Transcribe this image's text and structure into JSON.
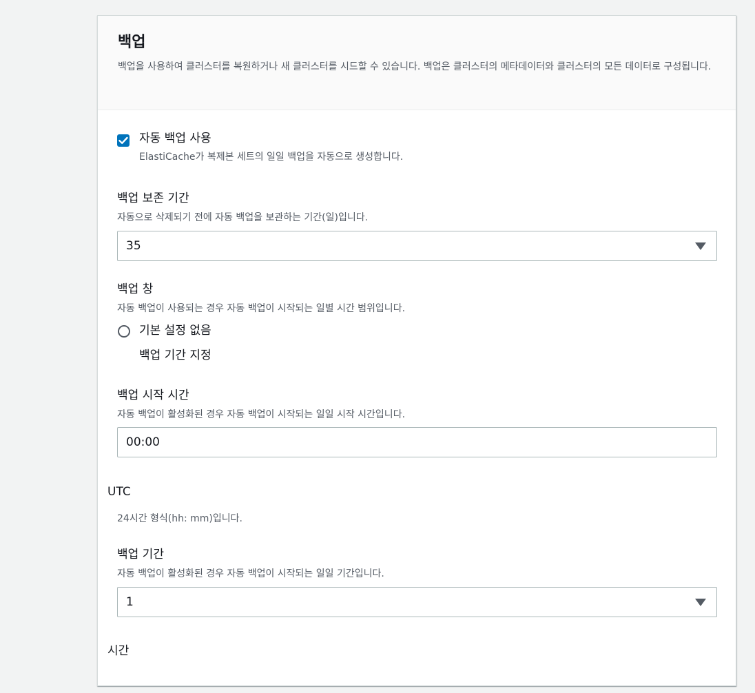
{
  "panel": {
    "title": "백업",
    "description": "백업을 사용하여 클러스터를 복원하거나 새 클러스터를 시드할 수 있습니다. 백업은 클러스터의 메타데이터와 클러스터의 모든 데이터로 구성됩니다."
  },
  "auto_backup": {
    "label": "자동 백업 사용",
    "description": "ElastiCache가 복제본 세트의 일일 백업을 자동으로 생성합니다.",
    "checked": true
  },
  "retention": {
    "label": "백업 보존 기간",
    "description": "자동으로 삭제되기 전에 자동 백업을 보관하는 기간(일)입니다.",
    "value": "35"
  },
  "window": {
    "label": "백업 창",
    "description": "자동 백업이 사용되는 경우 자동 백업이 시작되는 일별 시간 범위입니다.",
    "options": [
      {
        "label": "기본 설정 없음",
        "selected": false
      },
      {
        "label": "백업 기간 지정",
        "selected": true
      }
    ]
  },
  "start_time": {
    "label": "백업 시작 시간",
    "description": "자동 백업이 활성화된 경우 자동 백업이 시작되는 일일 시작 시간입니다.",
    "value": "00:00",
    "unit": "UTC",
    "hint": "24시간 형식(hh: mm)입니다."
  },
  "duration": {
    "label": "백업 기간",
    "description": "자동 백업이 활성화된 경우 자동 백업이 시작되는 일일 기간입니다.",
    "value": "1",
    "unit": "시간"
  },
  "colors": {
    "accent": "#0073bb",
    "page_bg": "#f2f3f3",
    "header_bg": "#fafafa",
    "secondary_text": "#545b64",
    "border": "#aab7b8"
  }
}
